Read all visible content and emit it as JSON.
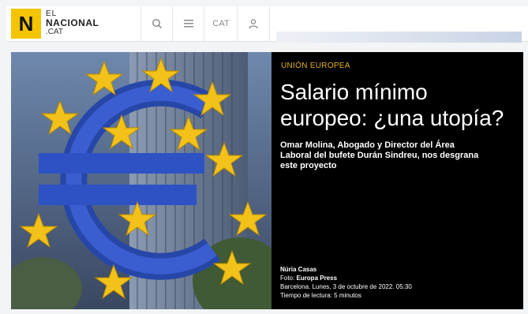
{
  "header": {
    "logo_letter": "N",
    "logo_line1": "EL",
    "logo_line2": "NACIONAL",
    "logo_line3": ".CAT",
    "language_label": "CAT"
  },
  "article": {
    "kicker": "UNIÓN EUROPEA",
    "title": "Salario mínimo europeo: ¿una utopía?",
    "subtitle": "Omar Molina, Abogado y Director del Área Laboral del bufete Durán Sindreu, nos desgrana este proyecto",
    "author": "Núria Casas",
    "photo_prefix": "Foto: ",
    "photo_credit": "Europa Press",
    "dateline": "Barcelona. Lunes, 3 de octubre de 2022. 05:30",
    "reading_time": "Tiempo de lectura: 5 minutos"
  },
  "colors": {
    "brand_yellow": "#f4c400",
    "kicker": "#e8b31b",
    "panel": "#000000"
  },
  "icons": [
    "search-icon",
    "menu-icon",
    "user-icon",
    "euro-sculpture-image"
  ]
}
